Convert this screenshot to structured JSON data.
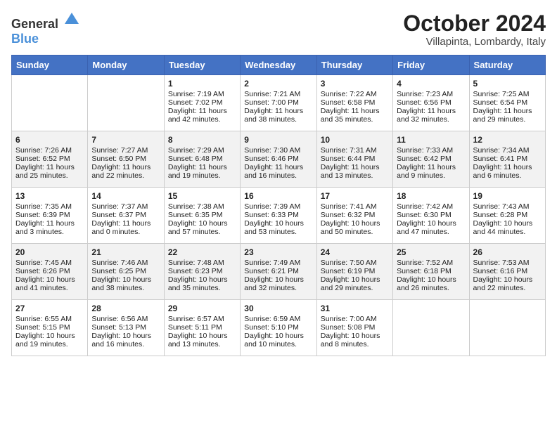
{
  "logo": {
    "general": "General",
    "blue": "Blue"
  },
  "title": "October 2024",
  "subtitle": "Villapinta, Lombardy, Italy",
  "weekdays": [
    "Sunday",
    "Monday",
    "Tuesday",
    "Wednesday",
    "Thursday",
    "Friday",
    "Saturday"
  ],
  "weeks": [
    [
      {
        "day": "",
        "content": ""
      },
      {
        "day": "",
        "content": ""
      },
      {
        "day": "1",
        "content": "Sunrise: 7:19 AM\nSunset: 7:02 PM\nDaylight: 11 hours and 42 minutes."
      },
      {
        "day": "2",
        "content": "Sunrise: 7:21 AM\nSunset: 7:00 PM\nDaylight: 11 hours and 38 minutes."
      },
      {
        "day": "3",
        "content": "Sunrise: 7:22 AM\nSunset: 6:58 PM\nDaylight: 11 hours and 35 minutes."
      },
      {
        "day": "4",
        "content": "Sunrise: 7:23 AM\nSunset: 6:56 PM\nDaylight: 11 hours and 32 minutes."
      },
      {
        "day": "5",
        "content": "Sunrise: 7:25 AM\nSunset: 6:54 PM\nDaylight: 11 hours and 29 minutes."
      }
    ],
    [
      {
        "day": "6",
        "content": "Sunrise: 7:26 AM\nSunset: 6:52 PM\nDaylight: 11 hours and 25 minutes."
      },
      {
        "day": "7",
        "content": "Sunrise: 7:27 AM\nSunset: 6:50 PM\nDaylight: 11 hours and 22 minutes."
      },
      {
        "day": "8",
        "content": "Sunrise: 7:29 AM\nSunset: 6:48 PM\nDaylight: 11 hours and 19 minutes."
      },
      {
        "day": "9",
        "content": "Sunrise: 7:30 AM\nSunset: 6:46 PM\nDaylight: 11 hours and 16 minutes."
      },
      {
        "day": "10",
        "content": "Sunrise: 7:31 AM\nSunset: 6:44 PM\nDaylight: 11 hours and 13 minutes."
      },
      {
        "day": "11",
        "content": "Sunrise: 7:33 AM\nSunset: 6:42 PM\nDaylight: 11 hours and 9 minutes."
      },
      {
        "day": "12",
        "content": "Sunrise: 7:34 AM\nSunset: 6:41 PM\nDaylight: 11 hours and 6 minutes."
      }
    ],
    [
      {
        "day": "13",
        "content": "Sunrise: 7:35 AM\nSunset: 6:39 PM\nDaylight: 11 hours and 3 minutes."
      },
      {
        "day": "14",
        "content": "Sunrise: 7:37 AM\nSunset: 6:37 PM\nDaylight: 11 hours and 0 minutes."
      },
      {
        "day": "15",
        "content": "Sunrise: 7:38 AM\nSunset: 6:35 PM\nDaylight: 10 hours and 57 minutes."
      },
      {
        "day": "16",
        "content": "Sunrise: 7:39 AM\nSunset: 6:33 PM\nDaylight: 10 hours and 53 minutes."
      },
      {
        "day": "17",
        "content": "Sunrise: 7:41 AM\nSunset: 6:32 PM\nDaylight: 10 hours and 50 minutes."
      },
      {
        "day": "18",
        "content": "Sunrise: 7:42 AM\nSunset: 6:30 PM\nDaylight: 10 hours and 47 minutes."
      },
      {
        "day": "19",
        "content": "Sunrise: 7:43 AM\nSunset: 6:28 PM\nDaylight: 10 hours and 44 minutes."
      }
    ],
    [
      {
        "day": "20",
        "content": "Sunrise: 7:45 AM\nSunset: 6:26 PM\nDaylight: 10 hours and 41 minutes."
      },
      {
        "day": "21",
        "content": "Sunrise: 7:46 AM\nSunset: 6:25 PM\nDaylight: 10 hours and 38 minutes."
      },
      {
        "day": "22",
        "content": "Sunrise: 7:48 AM\nSunset: 6:23 PM\nDaylight: 10 hours and 35 minutes."
      },
      {
        "day": "23",
        "content": "Sunrise: 7:49 AM\nSunset: 6:21 PM\nDaylight: 10 hours and 32 minutes."
      },
      {
        "day": "24",
        "content": "Sunrise: 7:50 AM\nSunset: 6:19 PM\nDaylight: 10 hours and 29 minutes."
      },
      {
        "day": "25",
        "content": "Sunrise: 7:52 AM\nSunset: 6:18 PM\nDaylight: 10 hours and 26 minutes."
      },
      {
        "day": "26",
        "content": "Sunrise: 7:53 AM\nSunset: 6:16 PM\nDaylight: 10 hours and 22 minutes."
      }
    ],
    [
      {
        "day": "27",
        "content": "Sunrise: 6:55 AM\nSunset: 5:15 PM\nDaylight: 10 hours and 19 minutes."
      },
      {
        "day": "28",
        "content": "Sunrise: 6:56 AM\nSunset: 5:13 PM\nDaylight: 10 hours and 16 minutes."
      },
      {
        "day": "29",
        "content": "Sunrise: 6:57 AM\nSunset: 5:11 PM\nDaylight: 10 hours and 13 minutes."
      },
      {
        "day": "30",
        "content": "Sunrise: 6:59 AM\nSunset: 5:10 PM\nDaylight: 10 hours and 10 minutes."
      },
      {
        "day": "31",
        "content": "Sunrise: 7:00 AM\nSunset: 5:08 PM\nDaylight: 10 hours and 8 minutes."
      },
      {
        "day": "",
        "content": ""
      },
      {
        "day": "",
        "content": ""
      }
    ]
  ]
}
